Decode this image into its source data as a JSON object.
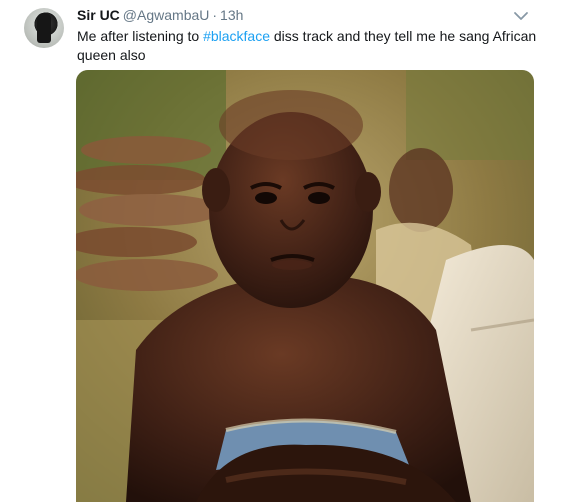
{
  "tweet": {
    "display_name": "Sir UC",
    "handle": "@AgwambaU",
    "separator": "·",
    "time": "13h",
    "text_before": "Me after listening to ",
    "hashtag": "#blackface",
    "text_after": " diss track and they tell me he sang African queen also"
  },
  "media": {
    "description": "child-photo"
  },
  "colors": {
    "link": "#1da1f2",
    "text": "#14171a",
    "muted": "#657786"
  },
  "icons": {
    "menu": "chevron-down-icon",
    "avatar": "avatar"
  }
}
